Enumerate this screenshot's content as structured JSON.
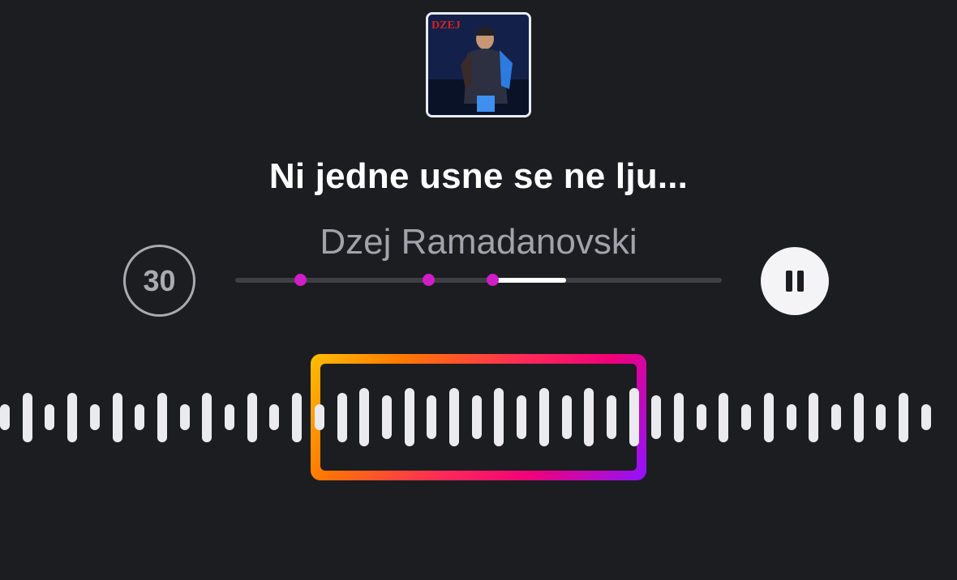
{
  "track": {
    "title": "Ni jedne usne se ne lju...",
    "artist": "Dzej Ramadanovski"
  },
  "album_art": {
    "logo_text": "DZEJ",
    "icon": "album-cover-image"
  },
  "controls": {
    "skip_label": "30",
    "skip_icon": "skip-30-seconds-icon",
    "pause_icon": "pause-icon"
  },
  "progress": {
    "position": 0.19,
    "segment_start": 0.53,
    "segment_end": 0.68,
    "markers": [
      0.134,
      0.396,
      0.529
    ]
  },
  "waveform": {
    "bar_count": 42,
    "heights": [
      0.45,
      0.85,
      0.45,
      0.85,
      0.45,
      0.85,
      0.45,
      0.85,
      0.45,
      0.85,
      0.45,
      0.85,
      0.45,
      0.85,
      0.45,
      0.85,
      1.0,
      0.75,
      1.0,
      0.75,
      1.0,
      0.75,
      1.0,
      0.75,
      1.0,
      0.75,
      1.0,
      0.75,
      1.0,
      0.75,
      0.85,
      0.45,
      0.85,
      0.45,
      0.85,
      0.45,
      0.85,
      0.45,
      0.85,
      0.45,
      0.85,
      0.45
    ],
    "selection_start_bar": 14,
    "selection_end_bar": 28
  },
  "colors": {
    "background": "#1c1d21",
    "marker": "#d01ec6",
    "frame_gradient": [
      "#ffbf00",
      "#ff2d55",
      "#8f12ff"
    ]
  }
}
